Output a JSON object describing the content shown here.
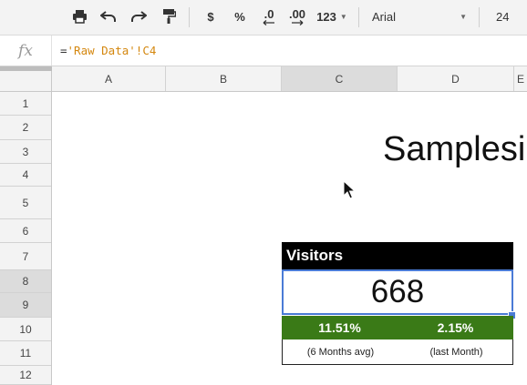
{
  "toolbar": {
    "currency_label": "$",
    "percent_label": "%",
    "decrease_decimal_label": ".0",
    "increase_decimal_label": ".00",
    "more_formats_label": "123",
    "font_name": "Arial",
    "font_size": "24"
  },
  "formula_bar": {
    "fx_label": "fx",
    "formula_prefix": "=",
    "formula_ref": "'Raw Data'!C4"
  },
  "columns": [
    "A",
    "B",
    "C",
    "D",
    "E"
  ],
  "rows": [
    "1",
    "2",
    "3",
    "4",
    "5",
    "6",
    "7",
    "8",
    "9",
    "10",
    "11",
    "12"
  ],
  "sheet": {
    "title": "Samplesi",
    "widget": {
      "header": "Visitors",
      "value": "668",
      "pct_left": "11.51%",
      "pct_right": "2.15%",
      "caption_left": "(6 Months avg)",
      "caption_right": "(last Month)"
    }
  },
  "colors": {
    "header_bg": "#000000",
    "green_bg": "#3a7a17",
    "selection": "#4a7bd6"
  }
}
